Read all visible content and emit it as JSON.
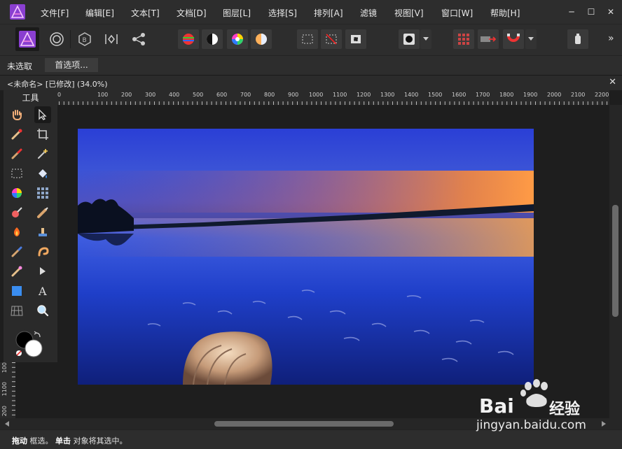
{
  "menu": {
    "items": [
      "文件[F]",
      "编辑[E]",
      "文本[T]",
      "文档[D]",
      "图层[L]",
      "选择[S]",
      "排列[A]",
      "滤镜",
      "视图[V]",
      "窗口[W]",
      "帮助[H]"
    ],
    "window_controls": {
      "minimize": "─",
      "maximize": "☐",
      "close": "✕"
    }
  },
  "toolbar": {
    "overflow": "»",
    "icons": [
      "persona-photo-icon",
      "persona-liquify-icon",
      "persona-develop-icon",
      "persona-tone-map-icon",
      "persona-export-icon",
      "levels-icon",
      "black-white-icon",
      "hsl-icon",
      "white-balance-icon",
      "marquee-icon",
      "deselect-icon",
      "invert-selection-icon",
      "mask-icon",
      "grid-icon",
      "assistant-icon",
      "snapping-icon",
      "pen-tablet-icon"
    ]
  },
  "context": {
    "selection_label": "未选取",
    "preferences_button": "首选项..."
  },
  "document": {
    "title": "<未命名> [已修改] (34.0%)",
    "close": "✕"
  },
  "tools": {
    "title": "工具"
  },
  "ruler": {
    "h_labels": [
      "0",
      "100",
      "200",
      "300",
      "400",
      "500",
      "600",
      "700",
      "800",
      "900",
      "1000",
      "1100",
      "1200",
      "1300",
      "1400",
      "1500",
      "1600",
      "1700",
      "1800",
      "1900",
      "2000",
      "2100",
      "2200"
    ],
    "v_labels": [
      "100",
      "1100",
      "200"
    ]
  },
  "status": {
    "drag_bold": "拖动",
    "drag_text": "框选。",
    "click_bold": "单击",
    "click_text": "对象将其选中。"
  },
  "watermark": {
    "logo_text": "Bai",
    "logo_cn": "经验",
    "url": "jingyan.baidu.com"
  }
}
